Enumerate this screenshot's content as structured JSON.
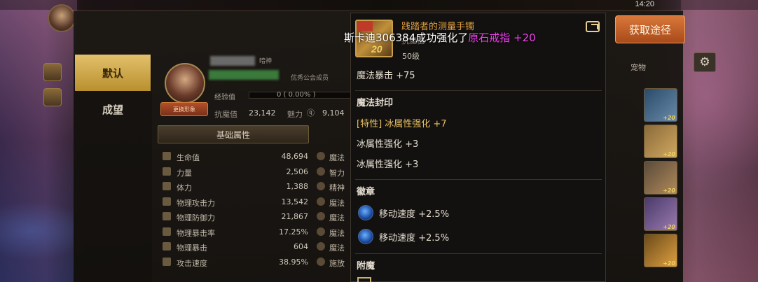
{
  "status": {
    "time": "14:20"
  },
  "notification": {
    "prefix": "斯卡迪306384成功强化了",
    "item": "原石戒指 +20"
  },
  "get_button": "获取途径",
  "tabs": [
    {
      "label": "默认",
      "active": true
    },
    {
      "label": "成望",
      "active": false
    }
  ],
  "profile": {
    "name_suffix": "暗神",
    "guild": "优秀公会成员",
    "exp_label": "经验值",
    "exp_value": "0 ( 0.00% )",
    "exp_progress": 0.0,
    "anti_demon_label": "抗魔值",
    "anti_demon_value": "23,142",
    "charm_label": "魅力",
    "charm_value": "9,104",
    "button": "更换形象"
  },
  "basic_tab": "基础属性",
  "attributes": [
    {
      "name": "生命值",
      "value": "48,694"
    },
    {
      "name": "力量",
      "value": "2,506"
    },
    {
      "name": "体力",
      "value": "1,388"
    },
    {
      "name": "物理攻击力",
      "value": "13,542"
    },
    {
      "name": "物理防御力",
      "value": "21,867"
    },
    {
      "name": "物理暴击率",
      "value": "17.25%"
    },
    {
      "name": "物理暴击",
      "value": "604"
    },
    {
      "name": "攻击速度",
      "value": "38.95%"
    }
  ],
  "attributes_right": [
    "魔法",
    "智力",
    "精神",
    "魔法",
    "魔法",
    "魔法",
    "魔法",
    "施放"
  ],
  "item": {
    "name": "践踏者的测量手镯",
    "type": "抗魔值",
    "level": "50级",
    "enhance": "20",
    "first_stat": "魔法暴击 +75"
  },
  "sections": {
    "magic_seal": {
      "title": "魔法封印",
      "lines": [
        {
          "text": "[特性] 冰属性强化 +7",
          "gold": true
        },
        {
          "text": "冰属性强化 +3",
          "gold": false
        },
        {
          "text": "冰属性强化 +3",
          "gold": false
        }
      ]
    },
    "emblem": {
      "title": "徽章",
      "lines": [
        "移动速度 +2.5%",
        "移动速度 +2.5%"
      ]
    },
    "enchant": {
      "title": "附魔"
    }
  },
  "right_panel": {
    "pet_label": "宠物"
  },
  "equip_slots": [
    "+20",
    "+20",
    "+20",
    "+20",
    "+20"
  ],
  "colors": {
    "highlight": "#f040f0",
    "gold_text": "#e8c060",
    "get_button": "#d9783a"
  }
}
